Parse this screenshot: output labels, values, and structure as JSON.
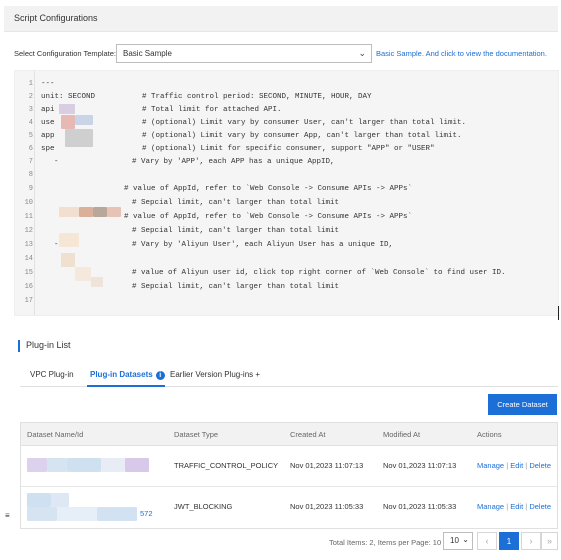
{
  "script_config": {
    "title": "Script Configurations",
    "template_label": "Select Configuration Template:",
    "template_value": "Basic Sample",
    "doc_link": "Basic Sample. And click to view the documentation.",
    "lines": [
      {
        "n": "1",
        "code": "---",
        "comment": ""
      },
      {
        "n": "2",
        "code": "unit: SECOND",
        "comment": "# Traffic control period: SECOND, MINUTE, HOUR, DAY"
      },
      {
        "n": "3",
        "code": "api",
        "comment": "# Total limit for attached API."
      },
      {
        "n": "4",
        "code": "use",
        "comment": "# (optional) Limit vary by consumer User, can't larger than total limit."
      },
      {
        "n": "5",
        "code": "app",
        "comment": "# (optional) Limit vary by consumer App, can't larger than total limit."
      },
      {
        "n": "6",
        "code": "spe",
        "comment": "# (optional) Limit for specific consumer, support \"APP\" or \"USER\""
      },
      {
        "n": "7",
        "code": "  -",
        "comment": "# Vary by 'APP', each APP has a unique AppID,"
      },
      {
        "n": "8",
        "code": "",
        "comment": ""
      },
      {
        "n": "9",
        "code": "",
        "comment": "# value of AppId, refer to `Web Console -> Consume APIs -> APPs`"
      },
      {
        "n": "10",
        "code": "",
        "comment": "# Sepcial limit, can't larger than total limit"
      },
      {
        "n": "11",
        "code": "",
        "comment": "# value of AppId, refer to `Web Console -> Consume APIs -> APPs`"
      },
      {
        "n": "12",
        "code": "",
        "comment": "# Sepcial limit, can't larger than total limit"
      },
      {
        "n": "13",
        "code": "  -",
        "comment": "# Vary by 'Aliyun User', each Aliyun User has a unique ID,"
      },
      {
        "n": "14",
        "code": "",
        "comment": ""
      },
      {
        "n": "15",
        "code": "",
        "comment": "# value of Aliyun user id, click top right corner of `Web Console` to find user ID."
      },
      {
        "n": "16",
        "code": "",
        "comment": "# Sepcial limit, can't larger than total limit"
      },
      {
        "n": "17",
        "code": "",
        "comment": ""
      }
    ]
  },
  "plugin_list": {
    "title": "Plug-in List",
    "tabs": [
      "VPC Plug-in",
      "Plug-in Datasets",
      "Earlier Version Plug-ins"
    ],
    "tab_suffix": "+",
    "create_button": "Create Dataset",
    "columns": [
      "Dataset Name/Id",
      "Dataset Type",
      "Created At",
      "Modified At",
      "Actions"
    ],
    "rows": [
      {
        "id_suffix": "",
        "type": "TRAFFIC_CONTROL_POLICY",
        "created": "Nov 01,2023 11:07:13",
        "modified": "Nov 01,2023 11:07:13"
      },
      {
        "id_suffix": "572",
        "type": "JWT_BLOCKING",
        "created": "Nov 01,2023 11:05:33",
        "modified": "Nov 01,2023 11:05:33"
      }
    ],
    "actions": {
      "manage": "Manage",
      "edit": "Edit",
      "delete": "Delete",
      "sep": "|"
    },
    "pagination": {
      "total_text": "Total Items: 2, Items per Page: 10",
      "page_size": "10",
      "current_page": "1"
    }
  },
  "colors": {
    "accent": "#1b6fd6",
    "editor_bg": "#f5f5f5"
  }
}
